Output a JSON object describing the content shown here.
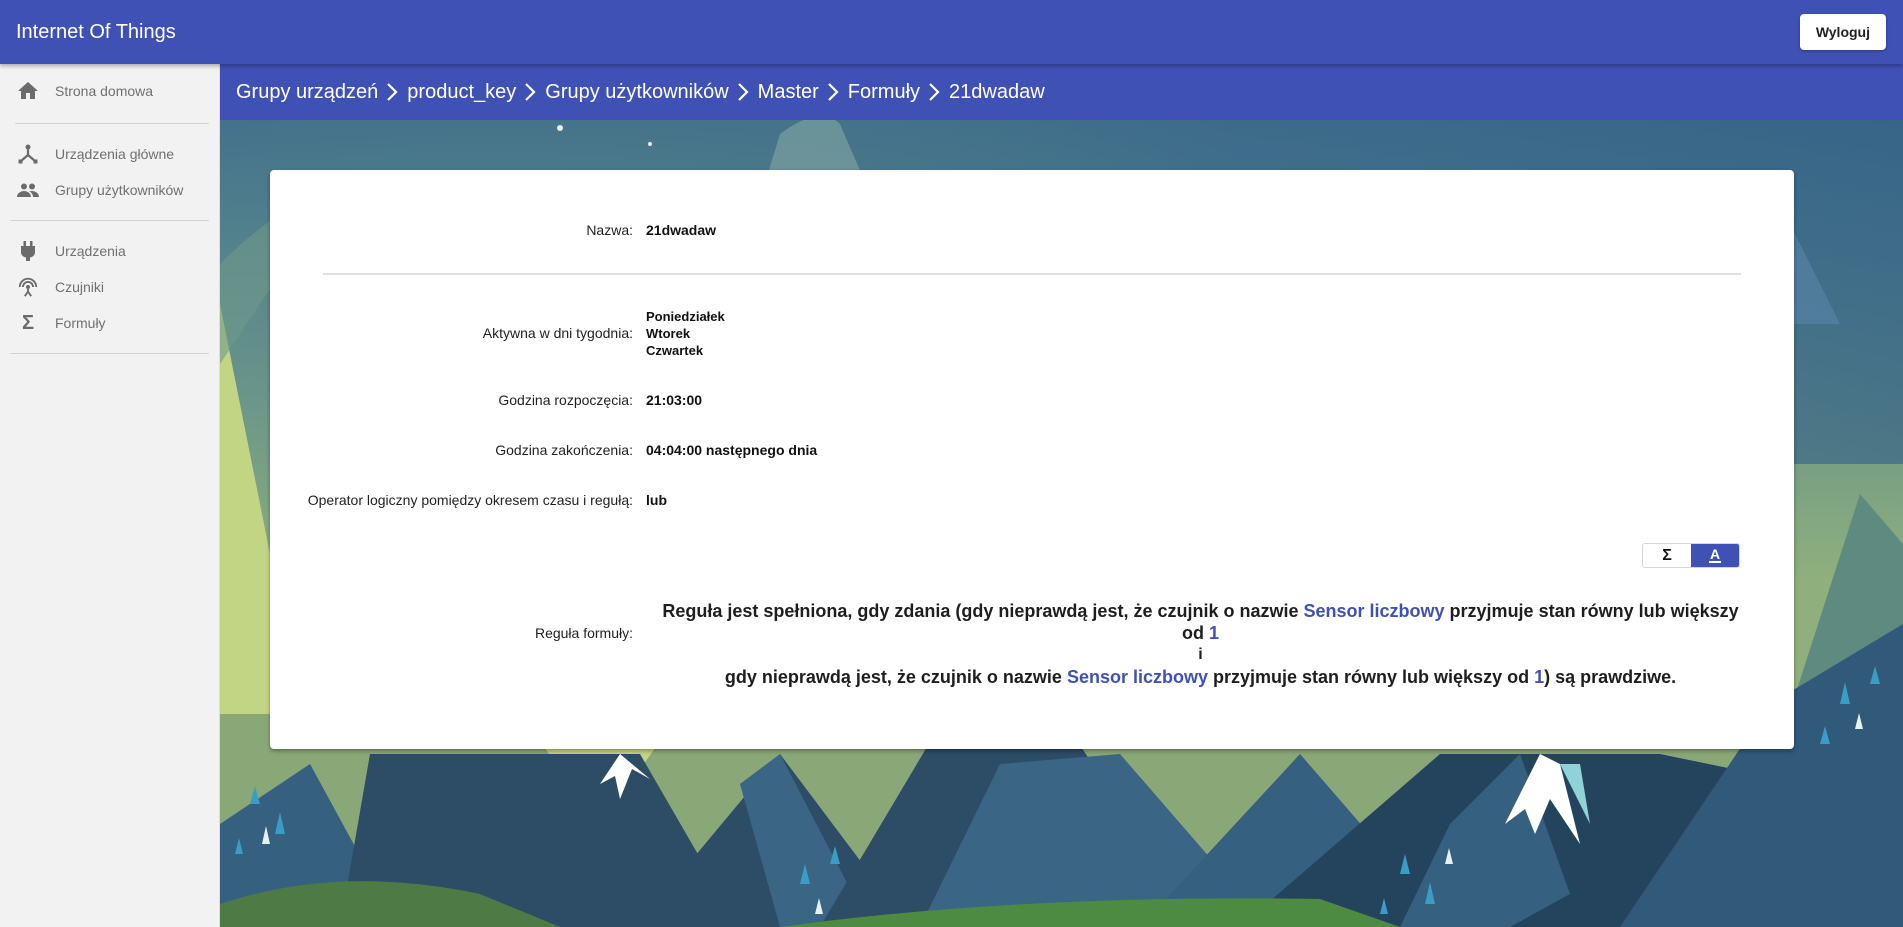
{
  "app": {
    "title": "Internet Of Things",
    "logout_label": "Wyloguj",
    "accent_color": "#3f51b5"
  },
  "sidebar": {
    "groups": [
      [
        {
          "label": "Strona domowa",
          "icon": "home-icon"
        }
      ],
      [
        {
          "label": "Urządzenia główne",
          "icon": "hub-icon"
        },
        {
          "label": "Grupy użytkowników",
          "icon": "people-icon"
        }
      ],
      [
        {
          "label": "Urządzenia",
          "icon": "plug-icon"
        },
        {
          "label": "Czujniki",
          "icon": "sensor-icon"
        },
        {
          "label": "Formuły",
          "icon": "sigma-icon"
        }
      ]
    ]
  },
  "breadcrumbs": [
    "Grupy urządzeń",
    "product_key",
    "Grupy użytkowników",
    "Master",
    "Formuły",
    "21dwadaw"
  ],
  "details": {
    "name_label": "Nazwa:",
    "name_value": "21dwadaw",
    "days_label": "Aktywna w dni tygodnia:",
    "days": [
      "Poniedziałek",
      "Wtorek",
      "Czwartek"
    ],
    "start_label": "Godzina rozpoczęcia:",
    "start_value": "21:03:00",
    "end_label": "Godzina zakończenia:",
    "end_value": "04:04:00 następnego dnia",
    "operator_label": "Operator logiczny pomiędzy okresem czasu i regułą:",
    "operator_value": "lub"
  },
  "view_toggle": {
    "formula_icon": "sigma-icon",
    "text_icon": "text-format-icon",
    "formula_glyph": "Σ",
    "text_glyph": "A",
    "active": "text"
  },
  "rule": {
    "label": "Reguła formuły:",
    "line1_prefix": "Reguła jest spełniona, gdy zdania (gdy nieprawdą jest, że czujnik o nazwie ",
    "line1_sensor": "Sensor liczbowy",
    "line1_middle": " przyjmuje stan równy lub większy od ",
    "line1_value": "1",
    "connector": "i",
    "line2_prefix": "gdy nieprawdą jest, że czujnik o nazwie ",
    "line2_sensor": "Sensor liczbowy",
    "line2_middle": " przyjmuje stan równy lub większy od ",
    "line2_value": "1",
    "line2_suffix": ") są prawdziwe."
  }
}
